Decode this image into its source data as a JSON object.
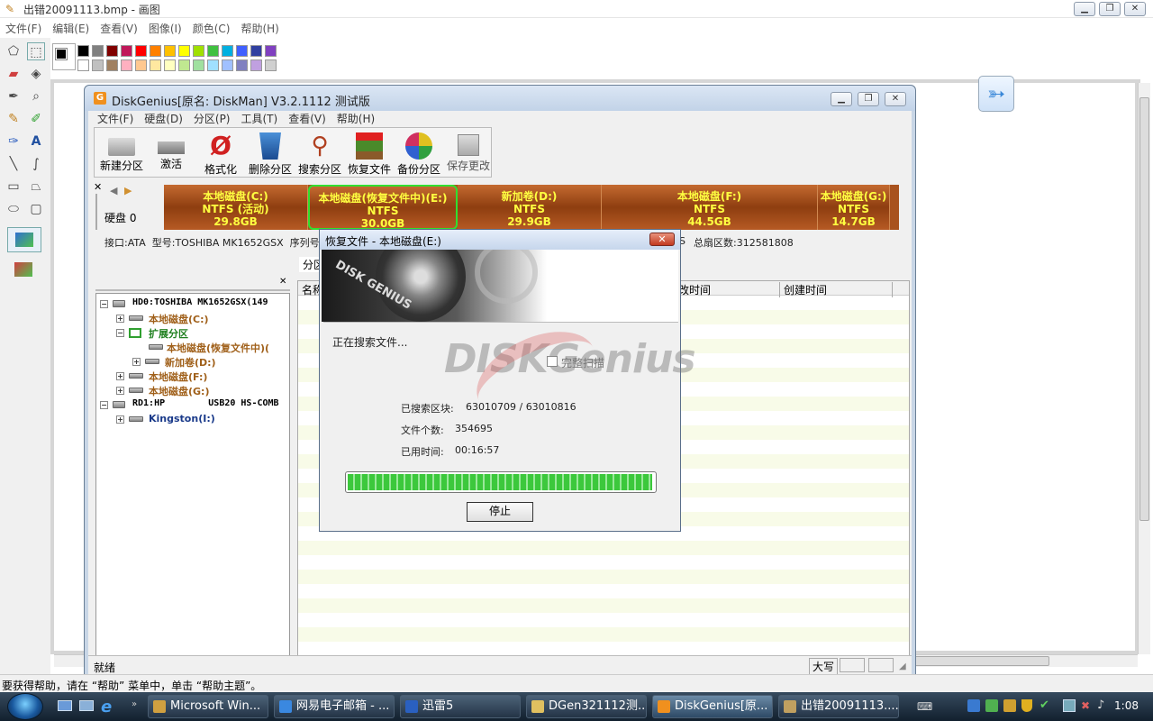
{
  "paint": {
    "title": "出错20091113.bmp - 画图",
    "menu": [
      "文件(F)",
      "编辑(E)",
      "查看(V)",
      "图像(I)",
      "颜色(C)",
      "帮助(H)"
    ],
    "status_help": "要获得帮助，请在 “帮助” 菜单中，单击 “帮助主题”。",
    "palette_top": [
      "#000000",
      "#808080",
      "#800000",
      "#c0185a",
      "#ff0000",
      "#ff8000",
      "#ffc000",
      "#ffff00",
      "#a0e000",
      "#40c040",
      "#00b0e0",
      "#4060ff",
      "#3040a0",
      "#8040c0"
    ],
    "palette_bottom": [
      "#ffffff",
      "#c0c0c0",
      "#a08060",
      "#ffb0c0",
      "#ffc890",
      "#ffe8a0",
      "#ffffc0",
      "#c0e890",
      "#a0e0a0",
      "#a0e0ff",
      "#a0c0ff",
      "#8080c0",
      "#c0a0e0",
      "#d0d0d0"
    ]
  },
  "diskgenius": {
    "title": "DiskGenius[原名: DiskMan] V3.2.1112 测试版",
    "menu": [
      "文件(F)",
      "硬盘(D)",
      "分区(P)",
      "工具(T)",
      "查看(V)",
      "帮助(H)"
    ],
    "toolbar": [
      "新建分区",
      "激活",
      "格式化",
      "删除分区",
      "搜索分区",
      "恢复文件",
      "备份分区",
      "保存更改"
    ],
    "disk_label": "硬盘 0",
    "partitions": [
      {
        "name": "本地磁盘(C:)",
        "fs": "NTFS (活动)",
        "size": "29.8GB"
      },
      {
        "name": "本地磁盘(恢复文件中)(E:)",
        "fs": "NTFS",
        "size": "30.0GB"
      },
      {
        "name": "新加卷(D:)",
        "fs": "NTFS",
        "size": "29.9GB"
      },
      {
        "name": "本地磁盘(F:)",
        "fs": "NTFS",
        "size": "44.5GB"
      },
      {
        "name": "本地磁盘(G:)",
        "fs": "NTFS",
        "size": "14.7GB"
      }
    ],
    "info_left": "接口:ATA  型号:TOSHIBA MK1652GSX  序列号",
    "info_right": "总扇区数:312581808",
    "info_fragment": "S",
    "tree": [
      "HD0:TOSHIBA MK1652GSX(149",
      "本地磁盘(C:)",
      "扩展分区",
      "本地磁盘(恢复文件中)(",
      "新加卷(D:)",
      "本地磁盘(F:)",
      "本地磁盘(G:)",
      "RD1:HP        USB20 HS-COMB",
      "Kingston(I:)"
    ],
    "tab_label": "分区",
    "col_name": "名称",
    "columns_right": [
      "改时间",
      "创建时间"
    ],
    "status": "就绪",
    "status_caps": "大写"
  },
  "dialog": {
    "title": "恢复文件 - 本地磁盘(E:)",
    "searching": "正在搜索文件...",
    "full_scan": "完整扫描",
    "blocks_label": "已搜索区块:",
    "blocks_value": "63010709 / 63010816",
    "files_label": "文件个数:",
    "files_value": "354695",
    "time_label": "已用时间:",
    "time_value": "00:16:57",
    "progress": 0.995,
    "stop": "停止",
    "watermark": "DISKGenius",
    "banner_text": "DISK GENIUS"
  },
  "taskbar": {
    "items": [
      "Microsoft Win...",
      "网易电子邮箱 - ...",
      "迅雷5",
      "DGen321112测...",
      "DiskGenius[原...",
      "出错20091113...."
    ],
    "clock": "1:08"
  }
}
